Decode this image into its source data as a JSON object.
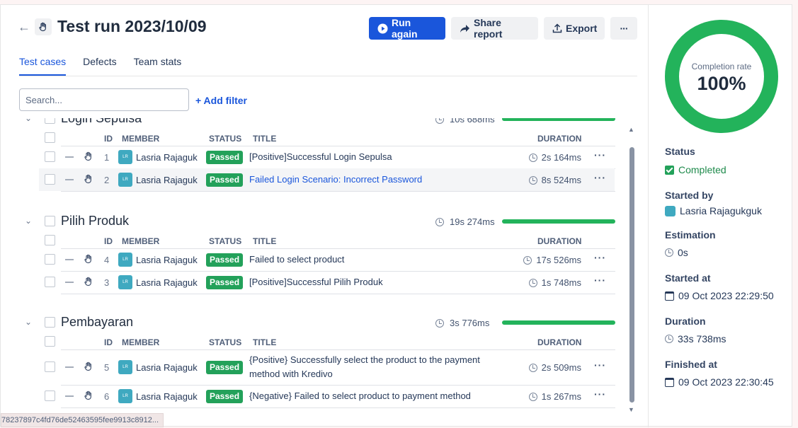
{
  "header": {
    "title": "Test run 2023/10/09",
    "run_again": "Run again",
    "share_report": "Share report",
    "export": "Export",
    "more": "···"
  },
  "tabs": [
    "Test cases",
    "Defects",
    "Team stats"
  ],
  "search": {
    "placeholder": "Search...",
    "value": ""
  },
  "add_filter": "+ Add filter",
  "columns": {
    "id": "ID",
    "member": "MEMBER",
    "status": "STATUS",
    "title": "TITLE",
    "duration": "DURATION"
  },
  "sections": [
    {
      "name": "Login Sepulsa",
      "time": "10s 688ms",
      "progress": 1.0,
      "rows": [
        {
          "id": "1",
          "member": "Lasria Rajaguk",
          "avatar": "LR",
          "status": "Passed",
          "title": "[Positive]Successful Login Sepulsa",
          "duration": "2s 164ms",
          "link": false,
          "highlight": false
        },
        {
          "id": "2",
          "member": "Lasria Rajaguk",
          "avatar": "LR",
          "status": "Passed",
          "title": "Failed Login Scenario: Incorrect Password",
          "duration": "8s 524ms",
          "link": true,
          "highlight": true
        }
      ]
    },
    {
      "name": "Pilih Produk",
      "time": "19s 274ms",
      "progress": 1.0,
      "rows": [
        {
          "id": "4",
          "member": "Lasria Rajaguk",
          "avatar": "LR",
          "status": "Passed",
          "title": "Failed to select product",
          "duration": "17s 526ms",
          "link": false,
          "highlight": false
        },
        {
          "id": "3",
          "member": "Lasria Rajaguk",
          "avatar": "LR",
          "status": "Passed",
          "title": "[Positive]Successful Pilih Produk",
          "duration": "1s 748ms",
          "link": false,
          "highlight": false
        }
      ]
    },
    {
      "name": "Pembayaran",
      "time": "3s 776ms",
      "progress": 1.0,
      "rows": [
        {
          "id": "5",
          "member": "Lasria Rajaguk",
          "avatar": "LR",
          "status": "Passed",
          "title": "{Positive} Successfully select the product to the payment method with Kredivo",
          "duration": "2s 509ms",
          "link": false,
          "highlight": false
        },
        {
          "id": "6",
          "member": "Lasria Rajaguk",
          "avatar": "LR",
          "status": "Passed",
          "title": "{Negative} Failed to select product to payment method",
          "duration": "1s 267ms",
          "link": false,
          "highlight": false
        }
      ]
    }
  ],
  "status_url": "78237897c4fd76de52463595fee9913c8912...",
  "panel": {
    "completion_label": "Completion rate",
    "completion_value": "100%",
    "completion_fraction": 1.0,
    "status_label": "Status",
    "status_value": "Completed",
    "started_by_label": "Started by",
    "started_by_value": "Lasria Rajagukguk",
    "estimation_label": "Estimation",
    "estimation_value": "0s",
    "started_at_label": "Started at",
    "started_at_value": "09 Oct 2023 22:29:50",
    "duration_label": "Duration",
    "duration_value": "33s 738ms",
    "finished_at_label": "Finished at",
    "finished_at_value": "09 Oct 2023 22:30:45"
  },
  "colors": {
    "accent": "#1a56db",
    "passed": "#23a15a",
    "progress": "#23b35b",
    "donut": "#23b35b"
  }
}
